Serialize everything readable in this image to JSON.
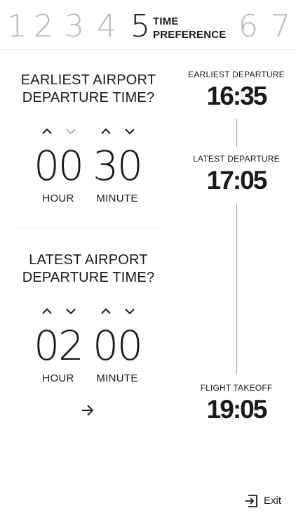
{
  "steps": {
    "numbers": [
      "1",
      "2",
      "3",
      "4",
      "5",
      "6",
      "7"
    ],
    "active_index": 4,
    "active_label_line1": "TIME",
    "active_label_line2": "PREFERENCE"
  },
  "earliest_picker": {
    "title_line1": "EARLIEST AIRPORT",
    "title_line2": "DEPARTURE TIME?",
    "hour": "00",
    "minute": "30",
    "hour_label": "HOUR",
    "minute_label": "MINUTE",
    "hour_down_disabled": true
  },
  "latest_picker": {
    "title_line1": "LATEST AIRPORT",
    "title_line2": "DEPARTURE TIME?",
    "hour": "02",
    "minute": "00",
    "hour_label": "HOUR",
    "minute_label": "MINUTE"
  },
  "timeline": {
    "earliest_label": "EARLIEST DEPARTURE",
    "earliest_time": "16:35",
    "latest_label": "LATEST DEPARTURE",
    "latest_time": "17:05",
    "takeoff_label": "FLIGHT TAKEOFF",
    "takeoff_time": "19:05"
  },
  "icons": {
    "up": "chevron-up-icon",
    "down": "chevron-down-icon",
    "next": "arrow-right-icon",
    "exit": "exit-icon"
  },
  "colors": {
    "text": "#1a1a1a",
    "inactive_step": "#b8b8b8",
    "disabled_chevron": "#b0b0b0",
    "timeline_line": "#9a9a9a"
  },
  "exit_label": "Exit"
}
